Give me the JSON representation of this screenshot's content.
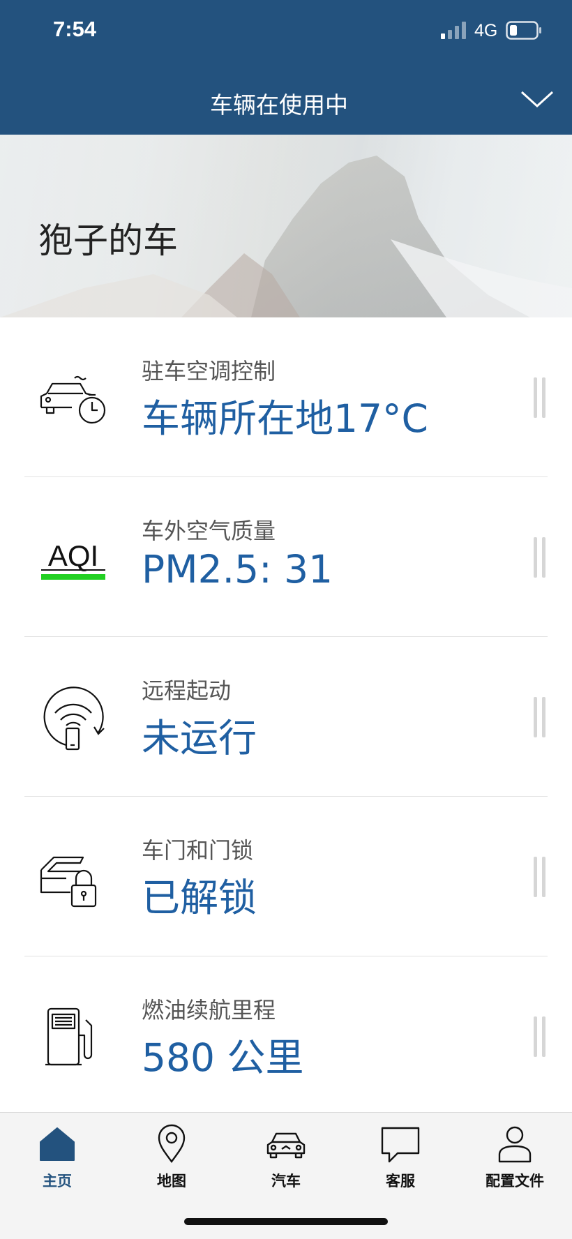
{
  "status_bar": {
    "time": "7:54",
    "network": "4G"
  },
  "header": {
    "title": "车辆在使用中"
  },
  "hero": {
    "title": "狍子的车"
  },
  "items": [
    {
      "label": "驻车空调控制",
      "value": "车辆所在地17°C",
      "icon": "parked-car-climate-timer-icon"
    },
    {
      "label": "车外空气质量",
      "value": "PM2.5: 31",
      "icon": "aqi-icon",
      "icon_text": "AQI",
      "icon_accent": "#22d022"
    },
    {
      "label": "远程起动",
      "value": "未运行",
      "icon": "remote-start-icon"
    },
    {
      "label": "车门和门锁",
      "value": "已解锁",
      "icon": "door-lock-icon"
    },
    {
      "label": "燃油续航里程",
      "value": "580 公里",
      "icon": "fuel-pump-icon"
    }
  ],
  "tabs": [
    {
      "label": "主页",
      "icon": "home-icon",
      "active": true
    },
    {
      "label": "地图",
      "icon": "map-pin-icon",
      "active": false
    },
    {
      "label": "汽车",
      "icon": "car-icon",
      "active": false
    },
    {
      "label": "客服",
      "icon": "chat-bubble-icon",
      "active": false
    },
    {
      "label": "配置文件",
      "icon": "profile-icon",
      "active": false
    }
  ],
  "colors": {
    "header_bg": "#23527e",
    "value_text": "#1f5fa2",
    "active_tab": "#23527e"
  }
}
